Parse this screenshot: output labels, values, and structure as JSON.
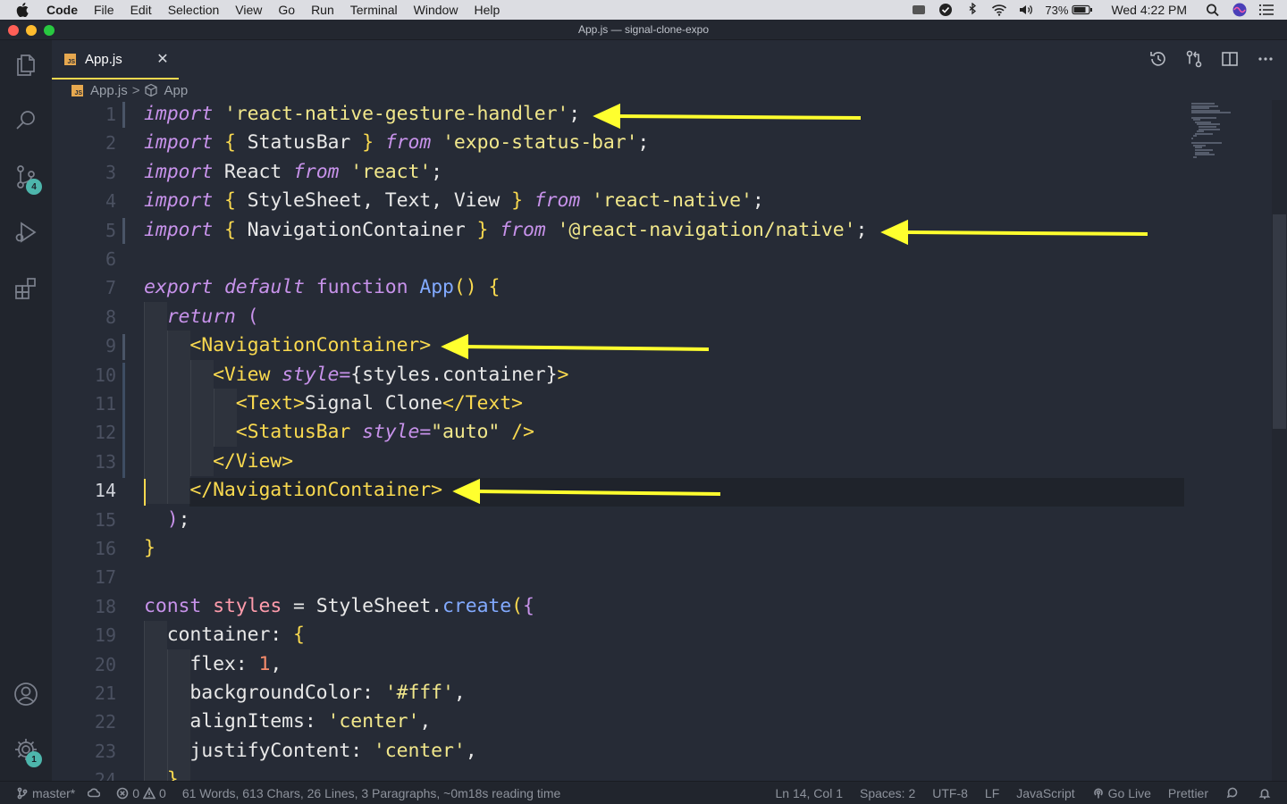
{
  "menubar": {
    "app_name": "Code",
    "items": [
      "File",
      "Edit",
      "Selection",
      "View",
      "Go",
      "Run",
      "Terminal",
      "Window",
      "Help"
    ],
    "battery": "73%",
    "clock": "Wed 4:22 PM"
  },
  "window": {
    "title": "App.js — signal-clone-expo"
  },
  "activity_bar": {
    "source_control_badge": "4",
    "settings_badge": "1"
  },
  "tab": {
    "icon_text": "JS",
    "label": "App.js",
    "close_glyph": "✕"
  },
  "breadcrumb": {
    "file": "App.js",
    "separator": ">",
    "symbol": "App"
  },
  "editor": {
    "active_line": "14",
    "line_numbers": [
      "1",
      "2",
      "3",
      "4",
      "5",
      "6",
      "7",
      "8",
      "9",
      "10",
      "11",
      "12",
      "13",
      "14",
      "15",
      "16",
      "17",
      "18",
      "19",
      "20",
      "21",
      "22",
      "23",
      "24"
    ],
    "code": {
      "l1_kw": "import",
      "l1_str": "'react-native-gesture-handler'",
      "l1_end": ";",
      "l2_kw": "import",
      "l2_a": "{",
      "l2_b": " StatusBar ",
      "l2_c": "}",
      "l2_from": "from",
      "l2_str": "'expo-status-bar'",
      "l2_end": ";",
      "l3_kw": "import",
      "l3_b": " React ",
      "l3_from": "from",
      "l3_str": "'react'",
      "l3_end": ";",
      "l4_kw": "import",
      "l4_a": "{",
      "l4_b": " StyleSheet, Text, View ",
      "l4_c": "}",
      "l4_from": "from",
      "l4_str": "'react-native'",
      "l4_end": ";",
      "l5_kw": "import",
      "l5_a": "{",
      "l5_b": " NavigationContainer ",
      "l5_c": "}",
      "l5_from": "from",
      "l5_str": "'@react-navigation/native'",
      "l5_end": ";",
      "l7_export": "export",
      "l7_default": "default",
      "l7_function": "function",
      "l7_name": "App",
      "l7_paren": "()",
      "l7_brace": "{",
      "l8_return": "return",
      "l8_paren": "(",
      "l9_tag": "<NavigationContainer>",
      "l10_open": "<View",
      "l10_attr": "style",
      "l10_eq": "=",
      "l10_val": "{styles.container}",
      "l10_close": ">",
      "l11_open": "<Text>",
      "l11_text": "Signal Clone",
      "l11_close": "</Text>",
      "l12_open": "<StatusBar",
      "l12_attr": "style",
      "l12_eq": "=",
      "l12_val": "\"auto\"",
      "l12_close": " />",
      "l13_tag": "</View>",
      "l14_tag": "</NavigationContainer>",
      "l15_paren": ")",
      "l15_end": ";",
      "l16_brace": "}",
      "l18_const": "const",
      "l18_var": "styles",
      "l18_eq": " = ",
      "l18_obj": "StyleSheet",
      "l18_dot": ".",
      "l18_fn": "create",
      "l18_paren": "(",
      "l18_brace": "{",
      "l19_key": "container:",
      "l19_brace": "{",
      "l20_key": "flex:",
      "l20_val": "1",
      "l20_end": ",",
      "l21_key": "backgroundColor:",
      "l21_val": "'#fff'",
      "l21_end": ",",
      "l22_key": "alignItems:",
      "l22_val": "'center'",
      "l22_end": ",",
      "l23_key": "justifyContent:",
      "l23_val": "'center'",
      "l23_end": ",",
      "l24_brace": "},"
    }
  },
  "statusbar": {
    "branch": "master*",
    "errors": "0",
    "warnings": "0",
    "word_count": "61 Words, 613 Chars, 26 Lines, 3 Paragraphs, ~0m18s reading time",
    "position": "Ln 14, Col 1",
    "spaces": "Spaces: 2",
    "encoding": "UTF-8",
    "eol": "LF",
    "language": "JavaScript",
    "go_live": "Go Live",
    "formatter": "Prettier"
  },
  "colors": {
    "accent": "#f9d94f",
    "keyword": "#c792ea",
    "string": "#f1e78b",
    "function": "#82aaff",
    "background": "#262b36",
    "arrow": "#ffff2e"
  }
}
